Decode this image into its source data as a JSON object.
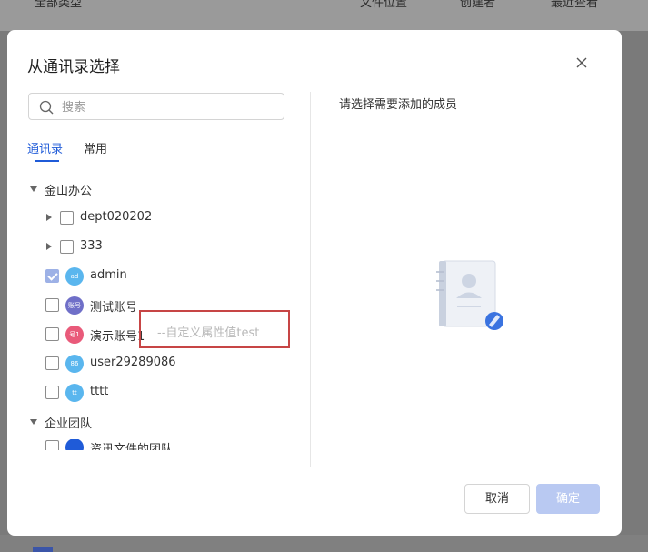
{
  "background": {
    "columns": [
      "全部类型",
      "文件位置",
      "创建者",
      "最近查看"
    ]
  },
  "dialog": {
    "title": "从通讯录选择",
    "search": {
      "placeholder": "搜索",
      "value": ""
    },
    "tabs": [
      {
        "label": "通讯录",
        "active": true
      },
      {
        "label": "常用",
        "active": false
      }
    ],
    "groups": [
      {
        "label": "金山办公",
        "expanded": true
      },
      {
        "label": "企业团队",
        "expanded": true
      }
    ],
    "departments": [
      {
        "label": "dept020202",
        "checked": false
      },
      {
        "label": "333",
        "checked": false
      }
    ],
    "members": [
      {
        "label": "admin",
        "avatar_text": "ad",
        "avatar_color": "#5ab6ee",
        "checked": true
      },
      {
        "label": "测试账号",
        "avatar_text": "账号",
        "avatar_color": "#6f6fc8",
        "checked": false
      },
      {
        "label": "演示账号1",
        "avatar_text": "号1",
        "avatar_color": "#e95a7a",
        "checked": false
      },
      {
        "label": "user29289086",
        "avatar_text": "86",
        "avatar_color": "#5ab6ee",
        "checked": false
      },
      {
        "label": "tttt",
        "avatar_text": "tt",
        "avatar_color": "#5ab6ee",
        "checked": false
      }
    ],
    "partial_member": {
      "label": "资讯文件的团队",
      "avatar_color": "#1f5bd8"
    },
    "custom_attribute": "--自定义属性值test",
    "right_panel": {
      "title": "请选择需要添加的成员"
    },
    "buttons": {
      "cancel": "取消",
      "confirm": "确定"
    },
    "colors": {
      "accent": "#1f5bd8",
      "confirm_disabled": "#b9c9f2",
      "highlight_border": "#c74545"
    }
  }
}
